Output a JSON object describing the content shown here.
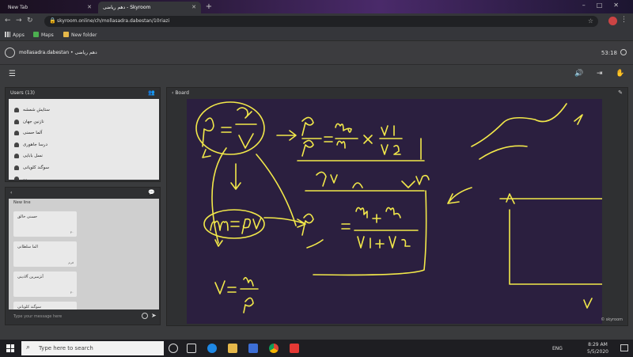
{
  "browser": {
    "tabs": [
      {
        "label": "New Tab"
      },
      {
        "label": "دهم ریاضی - Skyroom"
      }
    ],
    "url": "skyroom.online/ch/mollasadra.dabestan/10riazi",
    "bookmarks": [
      "Apps",
      "Maps",
      "New folder"
    ]
  },
  "header": {
    "user_name": "mollasadra.dabestan • دهم ریاضی",
    "clock": "53:18"
  },
  "users_panel": {
    "title": "Users (13)",
    "users": [
      "",
      "ستایش شمشه",
      "نازنین جهان",
      "آلما حسنی",
      "درسا جاهوری",
      "نسل بابایی",
      "سوگند کلویانی",
      "..."
    ]
  },
  "chat_panel": {
    "newline_text": "New line",
    "messages": [
      {
        "author": "حسنی خالق",
        "time": "۳۰"
      },
      {
        "author": "الما سلطانی",
        "time": "فرم"
      },
      {
        "author": "آنژمبرین آلادینی",
        "time": "۳۰"
      },
      {
        "author": "سوگند کلویانی",
        "time": "۳۰"
      }
    ],
    "input_placeholder": "Type your message here"
  },
  "board_panel": {
    "title": "Board",
    "logo": "© skyroom"
  },
  "taskbar": {
    "search_placeholder": "Type here to search",
    "lang": "ENG",
    "time": "8:29 AM",
    "date": "5/5/2020"
  },
  "colors": {
    "board_bg": "#2b1f3f",
    "ink": "#f2e84a"
  }
}
